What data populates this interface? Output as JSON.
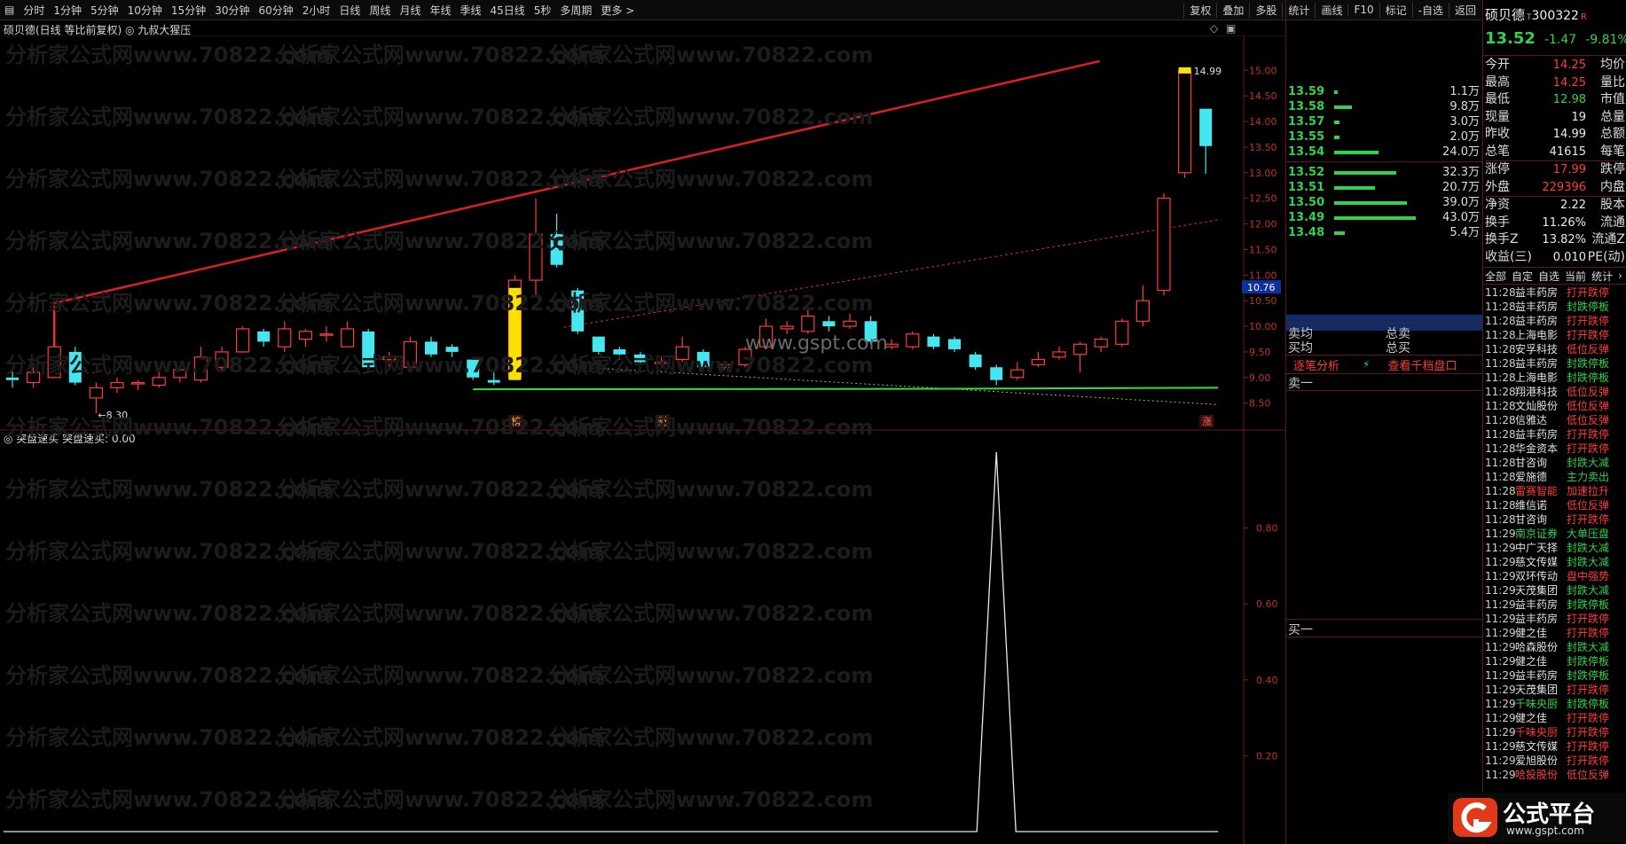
{
  "toolbar": {
    "items": [
      "分时",
      "1分钟",
      "5分钟",
      "10分钟",
      "15分钟",
      "30分钟",
      "60分钟",
      "2小时",
      "日线",
      "周线",
      "月线",
      "年线",
      "季线",
      "45日线",
      "5秒",
      "多周期",
      "更多 >"
    ],
    "right_items": [
      "复权",
      "叠加",
      "多股",
      "统计",
      "画线",
      "F10",
      "标记",
      "-自选",
      "返回"
    ]
  },
  "chart": {
    "header": "硕贝德(日线 等比前复权) ◎ 九叔大猩压",
    "marker_high": "14.99",
    "marker_low": "←8.30",
    "event_labels": [
      "榜",
      "财",
      "涨"
    ],
    "center_watermark": "www.gspt.com",
    "current_price_label": "10.76",
    "y_ticks": [
      "15.00",
      "14.50",
      "14.00",
      "13.50",
      "13.00",
      "12.50",
      "12.00",
      "11.50",
      "11.00",
      "10.50",
      "10.00",
      "9.50",
      "9.00",
      "8.50"
    ],
    "indicator_header": "◎ 突盘速买  突盘速买: 0.00",
    "indicator_y_ticks": [
      "0.80",
      "0.60",
      "0.40",
      "0.20"
    ]
  },
  "watermark_text": "分析家公式网www.70822.com",
  "order_book": {
    "asks": [
      {
        "price": "13.59",
        "vol": "1.1万"
      },
      {
        "price": "13.58",
        "vol": "9.8万"
      },
      {
        "price": "13.57",
        "vol": "3.0万"
      },
      {
        "price": "13.55",
        "vol": "2.0万"
      },
      {
        "price": "13.54",
        "vol": "24.0万"
      }
    ],
    "bids": [
      {
        "price": "13.52",
        "vol": "32.3万"
      },
      {
        "price": "13.51",
        "vol": "20.7万"
      },
      {
        "price": "13.50",
        "vol": "39.0万"
      },
      {
        "price": "13.49",
        "vol": "43.0万"
      },
      {
        "price": "13.48",
        "vol": "5.4万"
      }
    ],
    "sell_avg": "卖均",
    "buy_avg": "买均",
    "total_sell": "总卖",
    "total_buy": "总买",
    "tick_analysis": "逐笔分析",
    "view_depth": "查看千档盘口",
    "sell_one": "卖一",
    "buy_one": "买一"
  },
  "quote": {
    "name": "硕贝德",
    "code": "300322",
    "badge": "R",
    "price": "13.52",
    "change": "-1.47",
    "pct": "-9.81%",
    "stats": [
      {
        "l": "今开",
        "v": "14.25",
        "r": "均价",
        "c": "red"
      },
      {
        "l": "最高",
        "v": "14.25",
        "r": "量比",
        "c": "red"
      },
      {
        "l": "最低",
        "v": "12.98",
        "r": "市值",
        "c": "green"
      },
      {
        "l": "现量",
        "v": "19",
        "r": "总量",
        "c": "white"
      },
      {
        "l": "昨收",
        "v": "14.99",
        "r": "总额",
        "c": "white"
      },
      {
        "l": "总笔",
        "v": "41615",
        "r": "每笔",
        "c": "white"
      },
      {
        "l": "涨停",
        "v": "17.99",
        "r": "跌停",
        "c": "red"
      },
      {
        "l": "外盘",
        "v": "229396",
        "r": "内盘",
        "c": "red"
      },
      {
        "l": "净资",
        "v": "2.22",
        "r": "股本",
        "c": "white"
      },
      {
        "l": "换手",
        "v": "11.26%",
        "r": "流通",
        "c": "white"
      },
      {
        "l": "换手Z",
        "v": "13.82%",
        "r": "流通Z",
        "c": "white"
      },
      {
        "l": "收益(三)",
        "v": "0.010",
        "r": "PE(动)",
        "c": "white"
      }
    ],
    "tabs": [
      "全部",
      "自定",
      "自选",
      "当前",
      "统计",
      "›"
    ]
  },
  "tape": [
    {
      "t": "11:28",
      "n": "益丰药房",
      "e": "打开跌停",
      "nc": "w",
      "ec": "r"
    },
    {
      "t": "11:28",
      "n": "益丰药房",
      "e": "封跌停板",
      "nc": "w",
      "ec": "g"
    },
    {
      "t": "11:28",
      "n": "益丰药房",
      "e": "打开跌停",
      "nc": "w",
      "ec": "r"
    },
    {
      "t": "11:28",
      "n": "上海电影",
      "e": "打开跌停",
      "nc": "w",
      "ec": "r"
    },
    {
      "t": "11:28",
      "n": "安孚科技",
      "e": "低位反弹",
      "nc": "w",
      "ec": "r"
    },
    {
      "t": "11:28",
      "n": "益丰药房",
      "e": "封跌停板",
      "nc": "w",
      "ec": "g"
    },
    {
      "t": "11:28",
      "n": "上海电影",
      "e": "封跌停板",
      "nc": "w",
      "ec": "g"
    },
    {
      "t": "11:28",
      "n": "翔港科技",
      "e": "低位反弹",
      "nc": "w",
      "ec": "r"
    },
    {
      "t": "11:28",
      "n": "文灿股份",
      "e": "低位反弹",
      "nc": "w",
      "ec": "r"
    },
    {
      "t": "11:28",
      "n": "信雅达",
      "e": "低位反弹",
      "nc": "w",
      "ec": "r"
    },
    {
      "t": "11:28",
      "n": "益丰药房",
      "e": "打开跌停",
      "nc": "w",
      "ec": "r"
    },
    {
      "t": "11:28",
      "n": "华金资本",
      "e": "打开跌停",
      "nc": "w",
      "ec": "r"
    },
    {
      "t": "11:28",
      "n": "甘咨询",
      "e": "封跌大减",
      "nc": "w",
      "ec": "g"
    },
    {
      "t": "11:28",
      "n": "爱施德",
      "e": "主力卖出",
      "nc": "w",
      "ec": "g"
    },
    {
      "t": "11:28",
      "n": "雷赛智能",
      "e": "加速拉升",
      "nc": "r",
      "ec": "r"
    },
    {
      "t": "11:28",
      "n": "维信诺",
      "e": "低位反弹",
      "nc": "w",
      "ec": "r"
    },
    {
      "t": "11:28",
      "n": "甘咨询",
      "e": "打开跌停",
      "nc": "w",
      "ec": "r"
    },
    {
      "t": "11:29",
      "n": "南京证券",
      "e": "大单压盘",
      "nc": "g",
      "ec": "g"
    },
    {
      "t": "11:29",
      "n": "中广天择",
      "e": "封跌大减",
      "nc": "w",
      "ec": "g"
    },
    {
      "t": "11:29",
      "n": "慈文传媒",
      "e": "封跌大减",
      "nc": "w",
      "ec": "g"
    },
    {
      "t": "11:29",
      "n": "双环传动",
      "e": "盘中强势",
      "nc": "w",
      "ec": "r"
    },
    {
      "t": "11:29",
      "n": "天茂集团",
      "e": "封跌大减",
      "nc": "w",
      "ec": "g"
    },
    {
      "t": "11:29",
      "n": "益丰药房",
      "e": "封跌停板",
      "nc": "w",
      "ec": "g"
    },
    {
      "t": "11:29",
      "n": "益丰药房",
      "e": "打开跌停",
      "nc": "w",
      "ec": "r"
    },
    {
      "t": "11:29",
      "n": "健之佳",
      "e": "打开跌停",
      "nc": "w",
      "ec": "r"
    },
    {
      "t": "11:29",
      "n": "哈森股份",
      "e": "封跌大减",
      "nc": "w",
      "ec": "g"
    },
    {
      "t": "11:29",
      "n": "健之佳",
      "e": "封跌停板",
      "nc": "w",
      "ec": "g"
    },
    {
      "t": "11:29",
      "n": "益丰药房",
      "e": "封跌停板",
      "nc": "w",
      "ec": "g"
    },
    {
      "t": "11:29",
      "n": "天茂集团",
      "e": "打开跌停",
      "nc": "w",
      "ec": "r"
    },
    {
      "t": "11:29",
      "n": "千味央厨",
      "e": "封跌停板",
      "nc": "g",
      "ec": "g"
    },
    {
      "t": "11:29",
      "n": "健之佳",
      "e": "打开跌停",
      "nc": "w",
      "ec": "r"
    },
    {
      "t": "11:29",
      "n": "千味央厨",
      "e": "打开跌停",
      "nc": "r",
      "ec": "r"
    },
    {
      "t": "11:29",
      "n": "慈文传媒",
      "e": "打开跌停",
      "nc": "w",
      "ec": "r"
    },
    {
      "t": "11:29",
      "n": "爱旭股份",
      "e": "打开跌停",
      "nc": "w",
      "ec": "r"
    },
    {
      "t": "11:29",
      "n": "哈投股份",
      "e": "低位反弹",
      "nc": "r",
      "ec": "r"
    }
  ],
  "logo": {
    "title": "公式平台",
    "url": "www.gspt.com"
  },
  "colors": {
    "up": "#ff3b3b",
    "down": "#45e6f0",
    "trend": "#e02020",
    "support": "#30e040",
    "accent_yellow": "#ffe000"
  },
  "chart_data": {
    "type": "candlestick",
    "y_range": [
      8.2,
      15.3
    ],
    "candles": [
      [
        9.0,
        8.95,
        9.2,
        8.8
      ],
      [
        8.9,
        9.1,
        9.2,
        8.8
      ],
      [
        9.0,
        9.6,
        10.3,
        9.0
      ],
      [
        9.5,
        8.9,
        9.6,
        8.85
      ],
      [
        8.6,
        8.8,
        8.9,
        8.3
      ],
      [
        8.8,
        8.9,
        9.0,
        8.7
      ],
      [
        8.9,
        8.9,
        8.95,
        8.75
      ],
      [
        8.85,
        9.0,
        9.1,
        8.8
      ],
      [
        9.0,
        9.15,
        9.2,
        8.9
      ],
      [
        8.95,
        9.4,
        9.6,
        8.9
      ],
      [
        9.2,
        9.5,
        9.6,
        9.1
      ],
      [
        9.5,
        9.95,
        10.0,
        9.5
      ],
      [
        9.9,
        9.7,
        9.95,
        9.6
      ],
      [
        9.6,
        9.95,
        10.1,
        9.5
      ],
      [
        9.75,
        9.9,
        9.95,
        9.6
      ],
      [
        9.85,
        9.85,
        10.0,
        9.7
      ],
      [
        9.6,
        9.95,
        10.1,
        9.6
      ],
      [
        9.9,
        9.2,
        9.95,
        9.1
      ],
      [
        9.35,
        9.4,
        9.5,
        9.2
      ],
      [
        9.2,
        9.7,
        9.8,
        9.2
      ],
      [
        9.7,
        9.45,
        9.8,
        9.4
      ],
      [
        9.6,
        9.5,
        9.65,
        9.4
      ],
      [
        9.35,
        9.0,
        9.4,
        8.95
      ],
      [
        8.95,
        8.9,
        9.1,
        8.85
      ],
      [
        9.0,
        10.9,
        11.0,
        8.95
      ],
      [
        10.9,
        11.8,
        12.5,
        10.6
      ],
      [
        11.8,
        11.2,
        12.2,
        11.15
      ],
      [
        10.7,
        9.9,
        10.75,
        9.85
      ],
      [
        9.8,
        9.5,
        9.8,
        9.45
      ],
      [
        9.55,
        9.45,
        9.6,
        9.35
      ],
      [
        9.45,
        9.3,
        9.5,
        9.25
      ],
      [
        9.3,
        9.3,
        9.4,
        9.2
      ],
      [
        9.35,
        9.6,
        9.8,
        9.3
      ],
      [
        9.5,
        9.2,
        9.55,
        9.15
      ],
      [
        9.2,
        9.25,
        9.3,
        9.15
      ],
      [
        9.25,
        9.55,
        9.6,
        9.2
      ],
      [
        9.6,
        10.0,
        10.15,
        9.55
      ],
      [
        9.95,
        10.0,
        10.1,
        9.85
      ],
      [
        9.9,
        10.2,
        10.35,
        9.85
      ],
      [
        10.1,
        10.0,
        10.2,
        9.9
      ],
      [
        10.0,
        10.1,
        10.25,
        9.95
      ],
      [
        10.1,
        9.7,
        10.2,
        9.65
      ],
      [
        9.6,
        9.65,
        9.75,
        9.55
      ],
      [
        9.6,
        9.85,
        9.9,
        9.55
      ],
      [
        9.8,
        9.6,
        9.85,
        9.55
      ],
      [
        9.75,
        9.55,
        9.8,
        9.5
      ],
      [
        9.45,
        9.2,
        9.5,
        9.15
      ],
      [
        9.2,
        8.95,
        9.25,
        8.85
      ],
      [
        9.0,
        9.15,
        9.3,
        8.95
      ],
      [
        9.25,
        9.35,
        9.5,
        9.2
      ],
      [
        9.4,
        9.5,
        9.6,
        9.35
      ],
      [
        9.45,
        9.65,
        9.7,
        9.1
      ],
      [
        9.6,
        9.75,
        9.8,
        9.5
      ],
      [
        9.65,
        10.1,
        10.15,
        9.6
      ],
      [
        10.1,
        10.5,
        10.8,
        10.0
      ],
      [
        10.7,
        12.5,
        12.6,
        10.6
      ],
      [
        13.0,
        14.99,
        14.99,
        12.9
      ],
      [
        14.25,
        13.52,
        14.25,
        12.98
      ]
    ],
    "markers": {
      "high": 14.99,
      "low": 8.3
    },
    "indicator": {
      "name": "突盘速买",
      "value": "0.00",
      "y_range": [
        0,
        1.0
      ],
      "spike_index": 47,
      "spike_value": 1.0
    }
  }
}
